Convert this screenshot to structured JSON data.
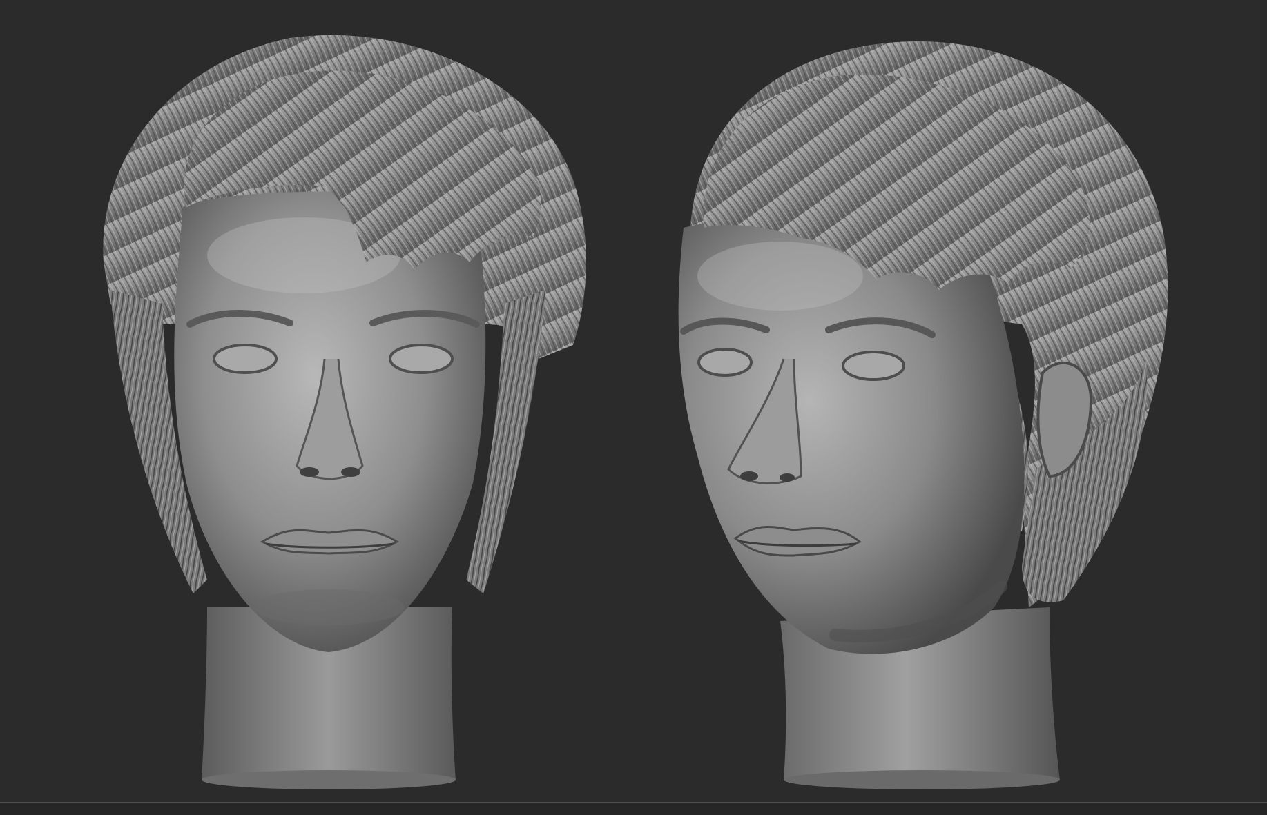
{
  "scene": {
    "views": [
      {
        "name": "front",
        "label": ""
      },
      {
        "name": "three-quarter",
        "label": ""
      }
    ]
  },
  "colors": {
    "background": "#2b2b2b",
    "clay_light": "#b9b9b9",
    "clay_mid": "#8a8a8a",
    "clay_dark": "#4a4a4a",
    "viewport_edge": "#4d4d4d"
  }
}
